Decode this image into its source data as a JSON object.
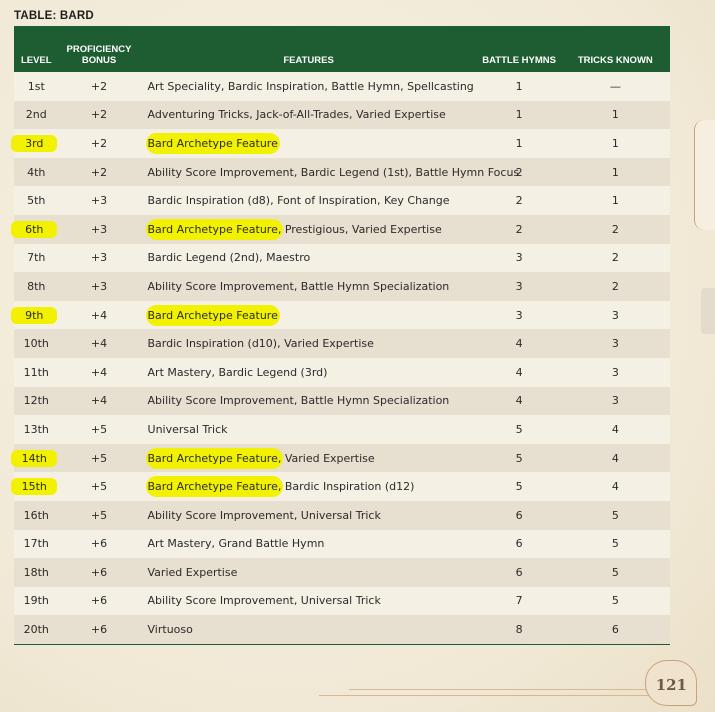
{
  "title": "TABLE: BARD",
  "columns": [
    "LEVEL",
    "PROFICIENCY BONUS",
    "FEATURES",
    "BATTLE HYMNS",
    "TRICKS KNOWN"
  ],
  "rows": [
    {
      "level": "1st",
      "prof": "+2",
      "feat_hl": "",
      "feat": "Art Speciality, Bardic Inspiration, Battle Hymn, Spellcasting",
      "hymns": "1",
      "tricks": "—",
      "highlight": false
    },
    {
      "level": "2nd",
      "prof": "+2",
      "feat_hl": "",
      "feat": "Adventuring Tricks, Jack-of-All-Trades, Varied Expertise",
      "hymns": "1",
      "tricks": "1",
      "highlight": false
    },
    {
      "level": "3rd",
      "prof": "+2",
      "feat_hl": "Bard Archetype Feature",
      "feat": "",
      "hymns": "1",
      "tricks": "1",
      "highlight": true
    },
    {
      "level": "4th",
      "prof": "+2",
      "feat_hl": "",
      "feat": "Ability Score Improvement, Bardic Legend (1st), Battle Hymn Focus",
      "hymns": "2",
      "tricks": "1",
      "highlight": false
    },
    {
      "level": "5th",
      "prof": "+3",
      "feat_hl": "",
      "feat": "Bardic Inspiration (d8), Font of Inspiration, Key Change",
      "hymns": "2",
      "tricks": "1",
      "highlight": false
    },
    {
      "level": "6th",
      "prof": "+3",
      "feat_hl": "Bard Archetype Feature,",
      "feat": " Prestigious, Varied Expertise",
      "hymns": "2",
      "tricks": "2",
      "highlight": true
    },
    {
      "level": "7th",
      "prof": "+3",
      "feat_hl": "",
      "feat": "Bardic Legend (2nd), Maestro",
      "hymns": "3",
      "tricks": "2",
      "highlight": false
    },
    {
      "level": "8th",
      "prof": "+3",
      "feat_hl": "",
      "feat": "Ability Score Improvement, Battle Hymn Specialization",
      "hymns": "3",
      "tricks": "2",
      "highlight": false
    },
    {
      "level": "9th",
      "prof": "+4",
      "feat_hl": "Bard Archetype Feature",
      "feat": "",
      "hymns": "3",
      "tricks": "3",
      "highlight": true
    },
    {
      "level": "10th",
      "prof": "+4",
      "feat_hl": "",
      "feat": "Bardic Inspiration (d10), Varied Expertise",
      "hymns": "4",
      "tricks": "3",
      "highlight": false
    },
    {
      "level": "11th",
      "prof": "+4",
      "feat_hl": "",
      "feat": "Art Mastery, Bardic Legend (3rd)",
      "hymns": "4",
      "tricks": "3",
      "highlight": false
    },
    {
      "level": "12th",
      "prof": "+4",
      "feat_hl": "",
      "feat": "Ability Score Improvement, Battle Hymn Specialization",
      "hymns": "4",
      "tricks": "3",
      "highlight": false
    },
    {
      "level": "13th",
      "prof": "+5",
      "feat_hl": "",
      "feat": "Universal Trick",
      "hymns": "5",
      "tricks": "4",
      "highlight": false
    },
    {
      "level": "14th",
      "prof": "+5",
      "feat_hl": "Bard Archetype Feature,",
      "feat": " Varied Expertise",
      "hymns": "5",
      "tricks": "4",
      "highlight": true
    },
    {
      "level": "15th",
      "prof": "+5",
      "feat_hl": "Bard Archetype Feature,",
      "feat": " Bardic Inspiration (d12)",
      "hymns": "5",
      "tricks": "4",
      "highlight": true
    },
    {
      "level": "16th",
      "prof": "+5",
      "feat_hl": "",
      "feat": "Ability Score Improvement, Universal Trick",
      "hymns": "6",
      "tricks": "5",
      "highlight": false
    },
    {
      "level": "17th",
      "prof": "+6",
      "feat_hl": "",
      "feat": "Art Mastery, Grand Battle Hymn",
      "hymns": "6",
      "tricks": "5",
      "highlight": false
    },
    {
      "level": "18th",
      "prof": "+6",
      "feat_hl": "",
      "feat": "Varied Expertise",
      "hymns": "6",
      "tricks": "5",
      "highlight": false
    },
    {
      "level": "19th",
      "prof": "+6",
      "feat_hl": "",
      "feat": "Ability Score Improvement, Universal Trick",
      "hymns": "7",
      "tricks": "5",
      "highlight": false
    },
    {
      "level": "20th",
      "prof": "+6",
      "feat_hl": "",
      "feat": "Virtuoso",
      "hymns": "8",
      "tricks": "6",
      "highlight": false
    }
  ],
  "page_number": "121",
  "colors": {
    "header_green": "#1e5d32",
    "highlight_yellow": "#f2f200",
    "parchment": "#f3ecdc"
  }
}
